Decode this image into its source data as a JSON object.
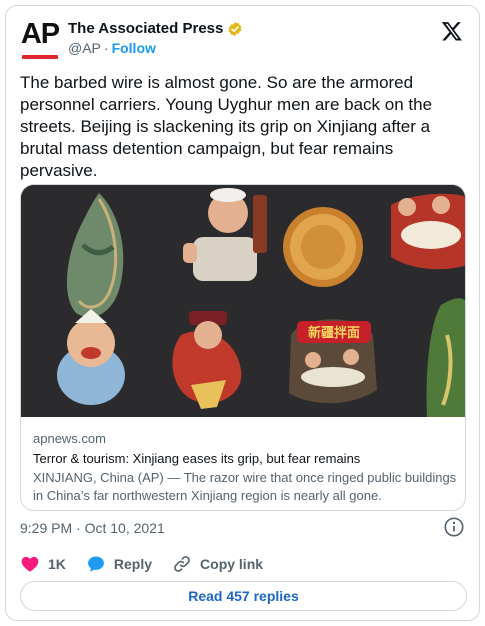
{
  "author": {
    "logo_text": "AP",
    "display_name": "The Associated Press",
    "verified_icon": "gold-verified-badge-icon",
    "handle": "@AP",
    "separator": "·",
    "follow_label": "Follow"
  },
  "tweet": {
    "text": "The barbed wire is almost gone. So are the armored personnel carriers. Young Uyghur men are back on the streets. Beijing is slackening its grip on Xinjiang after a brutal mass detention campaign, but fear remains pervasive."
  },
  "link_card": {
    "image_icon": "photo-of-xinjiang-souvenir-magnets",
    "image_sign_text": "新疆拌面",
    "domain": "apnews.com",
    "title": "Terror & tourism: Xinjiang eases its grip, but fear remains",
    "description": "XINJIANG, China (AP) — The razor wire that once ringed public buildings in China’s far northwestern Xinjiang region is nearly all gone."
  },
  "timestamp": "9:29 PM · Oct 10, 2021",
  "actions": {
    "like_count": "1K",
    "reply_label": "Reply",
    "copy_link_label": "Copy link"
  },
  "read_replies_label": "Read 457 replies",
  "colors": {
    "accent": "#1d9bf0",
    "like": "#f91880",
    "verified_gold": "#e2b719",
    "ap_red": "#e0262e"
  }
}
